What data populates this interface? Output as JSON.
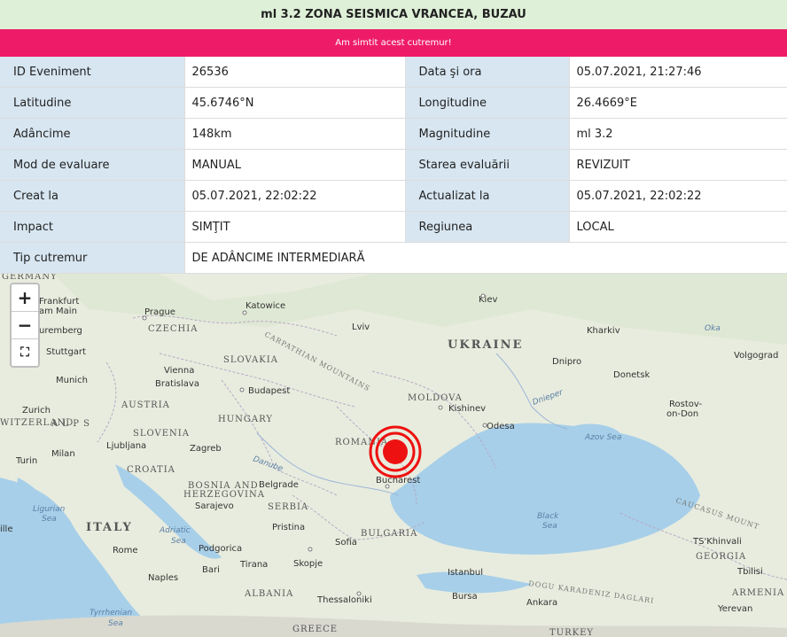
{
  "header": {
    "title": "ml 3.2 ZONA SEISMICA VRANCEA, BUZAU"
  },
  "felt_button": {
    "label": "Am simtit acest cutremur!"
  },
  "details": {
    "event_id_label": "ID Eveniment",
    "event_id": "26536",
    "datetime_label": "Data şi ora",
    "datetime": "05.07.2021, 21:27:46",
    "lat_label": "Latitudine",
    "lat": "45.6746°N",
    "lon_label": "Longitudine",
    "lon": "26.4669°E",
    "depth_label": "Adâncime",
    "depth": "148km",
    "mag_label": "Magnitudine",
    "mag": "ml 3.2",
    "eval_mode_label": "Mod de evaluare",
    "eval_mode": "MANUAL",
    "eval_state_label": "Starea evaluării",
    "eval_state": "REVIZUIT",
    "created_label": "Creat la",
    "created": "05.07.2021, 22:02:22",
    "updated_label": "Actualizat la",
    "updated": "05.07.2021, 22:02:22",
    "impact_label": "Impact",
    "impact": "SIMŢIT",
    "region_label": "Regiunea",
    "region": "LOCAL",
    "type_label": "Tip cutremur",
    "type": "DE ADÂNCIME INTERMEDIARĂ"
  },
  "map": {
    "zoom_in": "+",
    "zoom_out": "−",
    "fullscreen": "⛶",
    "cities": {
      "frankfurt": "Frankfurt",
      "am_main": "am Main",
      "nuremberg": "uremberg",
      "stuttgart": "Stuttgart",
      "munich": "Munich",
      "zurich": "Zurich",
      "turin": "Turin",
      "milan": "Milan",
      "prague": "Prague",
      "katowice": "Katowice",
      "lviv": "Lviv",
      "kiev": "Kiev",
      "kharkiv": "Kharkiv",
      "volgograd": "Volgograd",
      "vienna": "Vienna",
      "bratislava": "Bratislava",
      "budapest": "Budapest",
      "dnipro": "Dnipro",
      "donetsk": "Donetsk",
      "rostov": "Rostov-",
      "rostov2": "on-Don",
      "kishinev": "Kishinev",
      "odesa": "Odesa",
      "ljubljana": "Ljubljana",
      "zagreb": "Zagreb",
      "belgrade": "Belgrade",
      "bucharest": "Bucharest",
      "sarajevo": "Sarajevo",
      "rome": "Rome",
      "podgorica": "Podgorica",
      "pristina": "Pristina",
      "sofia": "Sofia",
      "naples": "Naples",
      "bari": "Bari",
      "tirana": "Tirana",
      "skopje": "Skopje",
      "istanbul": "Istanbul",
      "bursa": "Bursa",
      "ankara": "Ankara",
      "thessaloniki": "Thessaloniki",
      "tskhinvali": "TS'Khinvali",
      "tbilisi": "Tbilisi",
      "yerevan": "Yerevan",
      "ille": "ille"
    },
    "countries": {
      "ukraine": "UKRAINE",
      "czechia": "CZECHIA",
      "slovakia": "SLOVAKIA",
      "austria": "AUSTRIA",
      "hungary": "HUNGARY",
      "moldova": "MOLDOVA",
      "romania": "ROMANIA",
      "slovenia": "SLOVENIA",
      "croatia": "CROATIA",
      "bosnia1": "BOSNIA AND",
      "bosnia2": "HERZEGOVINA",
      "serbia": "SERBIA",
      "italy": "ITALY",
      "bulgaria": "BULGARIA",
      "georgia": "GEORGIA",
      "armenia": "ARMENIA",
      "albania": "ALBANIA",
      "switzerland": "WITZERLAND",
      "germany": "GERMANY",
      "greece": "GREECE",
      "turkey": "TURKEY",
      "alps": "A L P S"
    },
    "seas": {
      "black_sea1": "Black",
      "black_sea2": "Sea",
      "azov": "Azov Sea",
      "adriatic1": "Adriatic",
      "adriatic2": "Sea",
      "ligurian1": "Ligurian",
      "ligurian2": "Sea",
      "tyrrhenian1": "Tyrrhenian",
      "tyrrhenian2": "Sea",
      "dnieper": "Dnieper",
      "danube": "Danube",
      "oka": "Oka"
    },
    "mountains": {
      "carpathian": "CARPATHIAN MOUNTAINS",
      "caucasus": "CAUCASUS MOUNT",
      "dogu": "DOGU KARADENIZ DAGLARI"
    },
    "epicenter_color": "#ee1111"
  }
}
